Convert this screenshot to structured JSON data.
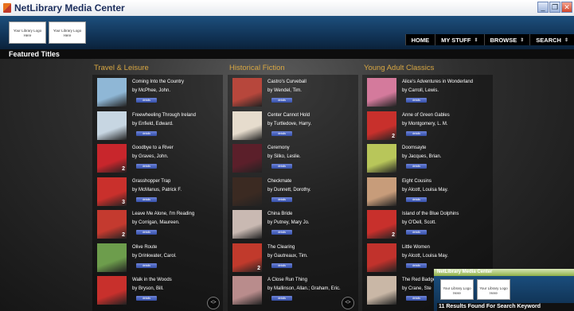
{
  "window": {
    "title": "NetLibrary Media Center",
    "controls": [
      "_",
      "❐",
      "✕"
    ]
  },
  "header": {
    "logos": [
      "Your Library Logo Here",
      "Your Library Logo Here"
    ],
    "nav": [
      {
        "label": "HOME",
        "dropdown": false
      },
      {
        "label": "MY STUFF",
        "dropdown": true
      },
      {
        "label": "BROWSE",
        "dropdown": true
      },
      {
        "label": "SEARCH",
        "dropdown": true
      }
    ]
  },
  "featured": {
    "label": "Featured Titles",
    "details_label": "details",
    "columns": [
      {
        "heading": "Travel & Leisure",
        "items": [
          {
            "title": "Coming Into the Country",
            "author": "by McPhee, John.",
            "cover": "#8fb7d6",
            "badge": ""
          },
          {
            "title": "Freewheeling Through Ireland",
            "author": "by Enfield, Edward.",
            "cover": "#c7d6e2",
            "badge": ""
          },
          {
            "title": "Goodbye to a River",
            "author": "by Graves, John.",
            "cover": "#c8262c",
            "badge": "2"
          },
          {
            "title": "Grasshopper Trap",
            "author": "by McManus, Patrick F.",
            "cover": "#c9302c",
            "badge": "3"
          },
          {
            "title": "Leave Me Alone, I'm Reading",
            "author": "by Corrigan, Maureen.",
            "cover": "#c43a2f",
            "badge": "2"
          },
          {
            "title": "Olive Route",
            "author": "by Drinkwater, Carol.",
            "cover": "#6d9d4c",
            "badge": ""
          },
          {
            "title": "Walk in the Woods",
            "author": "by Bryson, Bill.",
            "cover": "#c8302c",
            "badge": ""
          }
        ]
      },
      {
        "heading": "Historical Fiction",
        "items": [
          {
            "title": "Castro's Curveball",
            "author": "by Wendel, Tim.",
            "cover": "#b7473c",
            "badge": ""
          },
          {
            "title": "Center Cannot Hold",
            "author": "by Turtledove, Harry.",
            "cover": "#e6dccd",
            "badge": ""
          },
          {
            "title": "Ceremony",
            "author": "by Silko, Leslie.",
            "cover": "#5b1f2a",
            "badge": ""
          },
          {
            "title": "Checkmate",
            "author": "by Dunnett, Dorothy.",
            "cover": "#3b2a22",
            "badge": ""
          },
          {
            "title": "China Bride",
            "author": "by Putney, Mary Jo.",
            "cover": "#c9b9b2",
            "badge": ""
          },
          {
            "title": "The Clearing",
            "author": "by Gautreaux, Tim.",
            "cover": "#c13a2c",
            "badge": "2"
          },
          {
            "title": "A Close Run Thing",
            "author": "by Mallinson, Allan.; Graham, Eric.",
            "cover": "#b98c8c",
            "badge": ""
          }
        ]
      },
      {
        "heading": "Young Adult Classics",
        "items": [
          {
            "title": "Alice's Adventures in Wonderland",
            "author": "by Carroll, Lewis.",
            "cover": "#d47a9c",
            "badge": ""
          },
          {
            "title": "Anne of Green Gables",
            "author": "by Montgomery, L. M.",
            "cover": "#c8302c",
            "badge": "2"
          },
          {
            "title": "Doomsayte",
            "author": "by Jacques, Brian.",
            "cover": "#b8c65a",
            "badge": ""
          },
          {
            "title": "Eight Cousins",
            "author": "by Alcott, Louisa May.",
            "cover": "#c79c7a",
            "badge": ""
          },
          {
            "title": "Island of the Blue Dolphins",
            "author": "by O'Dell, Scott.",
            "cover": "#c8302c",
            "badge": "2"
          },
          {
            "title": "Little Women",
            "author": "by Alcott, Louisa May.",
            "cover": "#c1322c",
            "badge": ""
          },
          {
            "title": "The Red Badge",
            "author": "by Crane, Ste",
            "cover": "#c9b7a6",
            "badge": ""
          }
        ]
      }
    ],
    "scroll_glyph": "︿\n﹀"
  },
  "popup": {
    "title": "NetLibrary Media Center",
    "logos": [
      "Your Library Logo Here",
      "Your Library Logo Here"
    ]
  },
  "results": {
    "text": "11 Results Found For Search Keyword"
  }
}
